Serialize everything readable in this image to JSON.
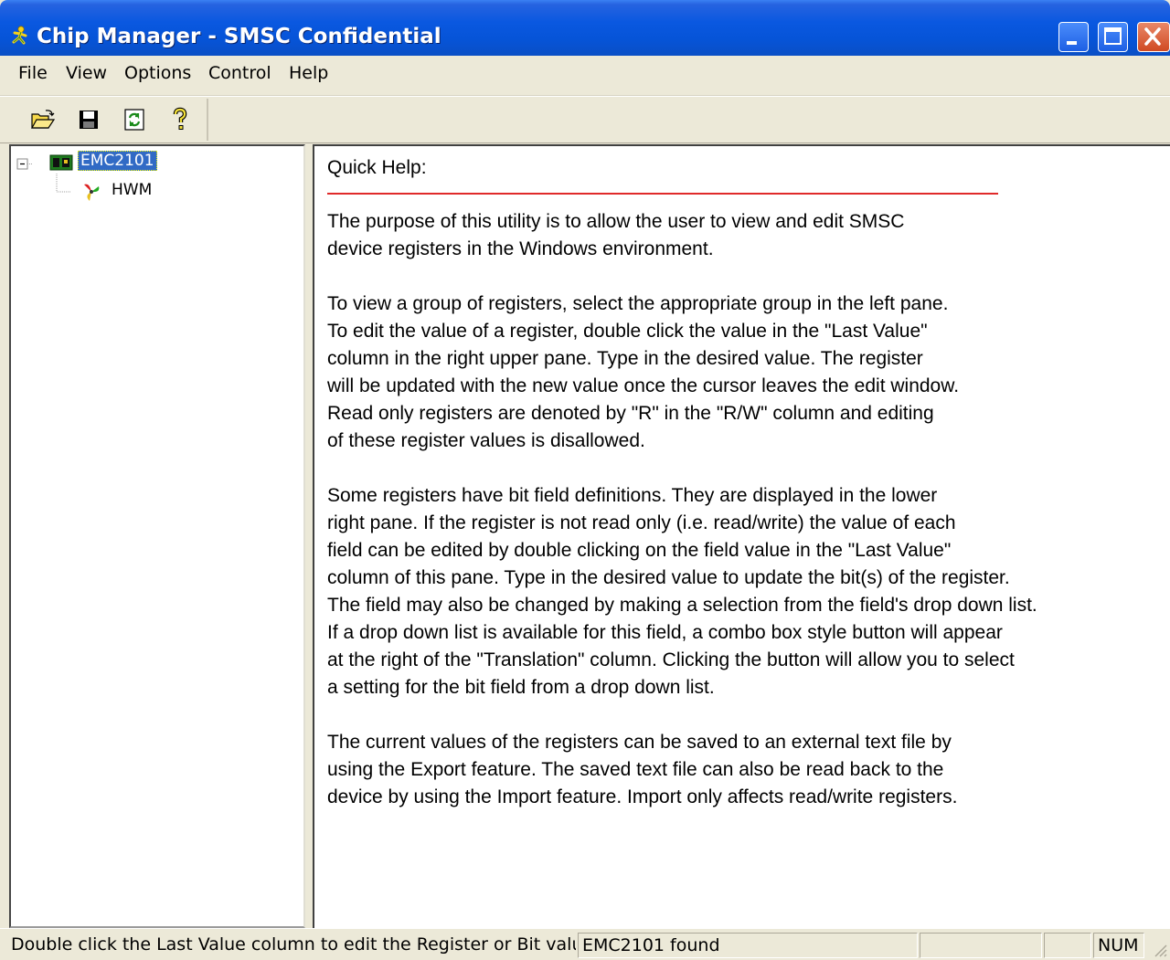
{
  "window": {
    "title": "Chip Manager - SMSC Confidential"
  },
  "menu": {
    "items": [
      "File",
      "View",
      "Options",
      "Control",
      "Help"
    ]
  },
  "toolbar": {
    "buttons": [
      "open-folder-icon",
      "save-disk-icon",
      "refresh-icon",
      "help-question-icon"
    ]
  },
  "tree": {
    "root_label": "EMC2101",
    "child_label": "HWM"
  },
  "help": {
    "title": "Quick Help:",
    "rule_color": "#e02a2a",
    "paragraphs": [
      "The purpose of this utility is to allow the user to view and edit SMSC\ndevice registers in the Windows environment.",
      "To view a group of registers, select the appropriate group in the left pane.\nTo edit the value of a register, double click the value in the \"Last Value\"\ncolumn in the right upper pane. Type in the desired value. The register\nwill be updated with the new value once the cursor leaves the edit window.\nRead only registers are denoted by \"R\" in the \"R/W\" column and editing\nof these register values is disallowed.",
      "Some registers have bit field definitions. They are displayed in the lower\nright pane. If the register is not read only (i.e. read/write) the value of each\nfield can be edited by double clicking on the field value in the \"Last Value\"\ncolumn of this pane. Type in the desired value to update the bit(s) of the register.\nThe field may also be changed by making a selection from the field's drop down list.\nIf a drop down list is available for this field, a combo box style button will appear\nat the right of the \"Translation\" column.  Clicking the button will allow you to select\na setting for the bit field from a drop down list.",
      "The current values of the registers can be saved to an external text file by\nusing the Export feature. The saved text file can also be read back to the\ndevice by using the Import feature. Import only affects read/write registers."
    ]
  },
  "status": {
    "message": "Double click the Last Value column to edit the Register or Bit value",
    "device": "EMC2101 found",
    "num": "NUM"
  },
  "colors": {
    "titlebar": "#0654d8",
    "selection": "#316ac5",
    "close_button": "#d04a22"
  }
}
